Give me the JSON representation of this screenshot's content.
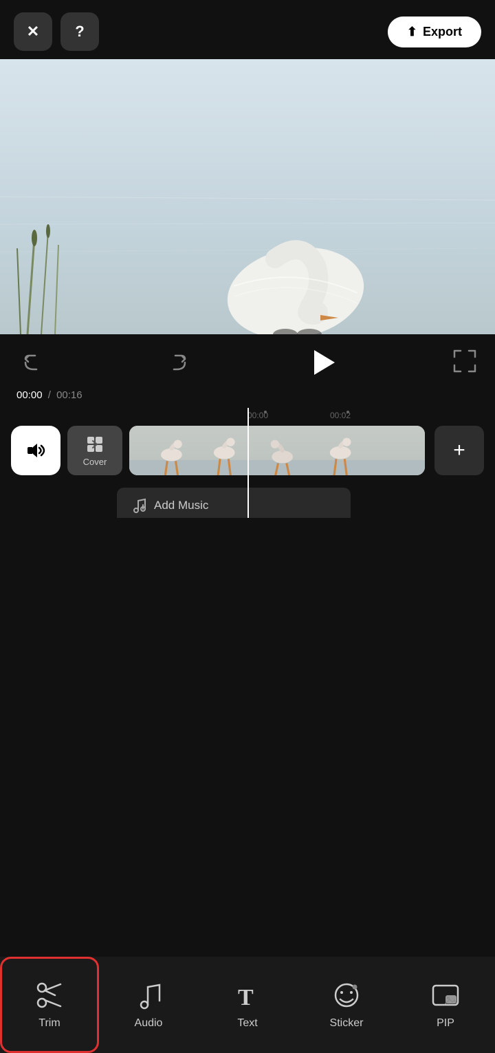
{
  "topBar": {
    "closeLabel": "✕",
    "helpLabel": "?",
    "exportLabel": "Export",
    "exportIcon": "⬆"
  },
  "controls": {
    "undoIcon": "↩",
    "redoIcon": "↪",
    "fullscreenIcon": "⛶"
  },
  "timeline": {
    "currentTime": "00:00",
    "totalTime": "00:16",
    "separator": "/",
    "playheadTime": "00:00",
    "mark1": "00:02"
  },
  "tracks": {
    "volumeIcon": "🔉",
    "coverLabel": "Cover",
    "addIcon": "+",
    "addMusicLabel": "Add Music"
  },
  "toolbar": {
    "items": [
      {
        "id": "trim",
        "label": "Trim",
        "icon": "✂",
        "active": true
      },
      {
        "id": "audio",
        "label": "Audio",
        "icon": "♪",
        "active": false
      },
      {
        "id": "text",
        "label": "Text",
        "icon": "T",
        "active": false
      },
      {
        "id": "sticker",
        "label": "Sticker",
        "icon": "◕",
        "active": false
      },
      {
        "id": "pip",
        "label": "PIP",
        "icon": "▨",
        "active": false
      }
    ]
  }
}
